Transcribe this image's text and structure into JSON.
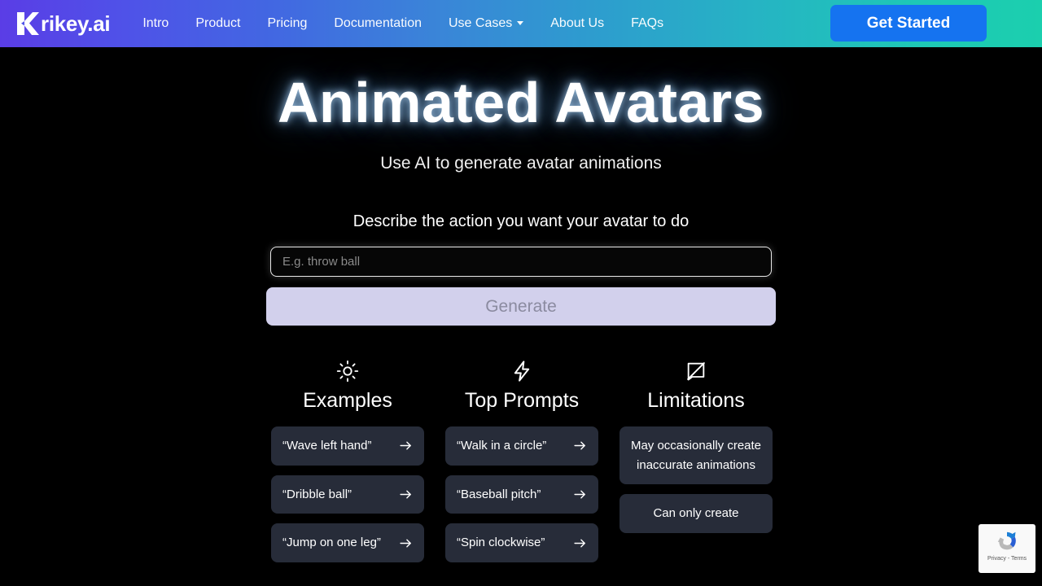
{
  "navbar": {
    "logo_text": "rikey.ai",
    "logo_icon": "krikey-k-logo-icon",
    "links": [
      {
        "label": "Intro",
        "dropdown": false
      },
      {
        "label": "Product",
        "dropdown": false
      },
      {
        "label": "Pricing",
        "dropdown": false
      },
      {
        "label": "Documentation",
        "dropdown": false
      },
      {
        "label": "Use Cases",
        "dropdown": true
      },
      {
        "label": "About Us",
        "dropdown": false
      },
      {
        "label": "FAQs",
        "dropdown": false
      }
    ],
    "cta_label": "Get Started",
    "cta_color": "#1573f0",
    "gradient_start": "#5a3de6",
    "gradient_end": "#1bcfae"
  },
  "hero": {
    "title": "Animated Avatars",
    "subtitle": "Use AI to generate avatar animations",
    "glow_color": "#b4dcff"
  },
  "prompt": {
    "label": "Describe the action you want your avatar to do",
    "input_value": "",
    "input_placeholder": "E.g. throw ball",
    "generate_label": "Generate",
    "generate_bg": "#d2d0ec",
    "generate_text_color": "#8b8ba0"
  },
  "columns": [
    {
      "id": "examples",
      "title": "Examples",
      "icon": "sun-icon",
      "has_arrows": true,
      "cards": [
        "“Wave left hand”",
        "“Dribble ball”",
        "“Jump on one leg”"
      ]
    },
    {
      "id": "top-prompts",
      "title": "Top Prompts",
      "icon": "lightning-bolt-icon",
      "has_arrows": true,
      "cards": [
        "“Walk in a circle”",
        "“Baseball pitch”",
        "“Spin clockwise”"
      ]
    },
    {
      "id": "limitations",
      "title": "Limitations",
      "icon": "crossed-out-message-icon",
      "has_arrows": false,
      "cards": [
        "May occasionally create inaccurate animations",
        "Can only create"
      ]
    }
  ],
  "recaptcha": {
    "text": "Privacy - Terms",
    "icon": "recaptcha-logo-icon"
  }
}
